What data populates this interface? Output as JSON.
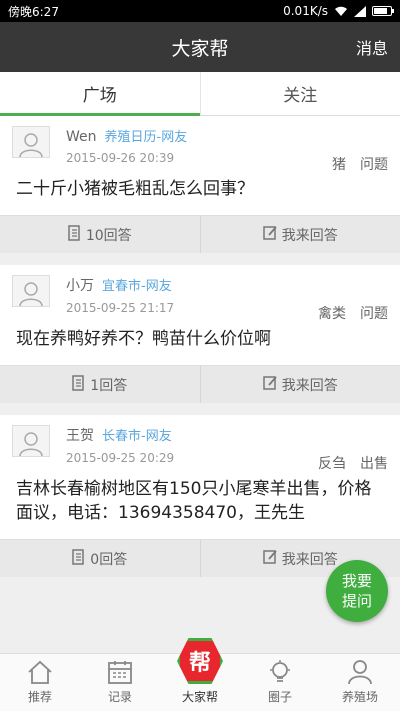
{
  "statusbar": {
    "left": "傍晚6:27",
    "speed": "0.01K/s"
  },
  "titlebar": {
    "title": "大家帮",
    "message": "消息"
  },
  "tabs": [
    {
      "label": "广场"
    },
    {
      "label": "关注"
    }
  ],
  "posts": [
    {
      "user": "Wen",
      "source": "养殖日历-网友",
      "time": "2015-09-26 20:39",
      "tags": [
        "猪",
        "问题"
      ],
      "question": "二十斤小猪被毛粗乱怎么回事？",
      "answers": "10回答",
      "reply": "我来回答"
    },
    {
      "user": "小万",
      "source": "宜春市-网友",
      "time": "2015-09-25 21:17",
      "tags": [
        "禽类",
        "问题"
      ],
      "question": "现在养鸭好养不？鸭苗什么价位啊",
      "answers": "1回答",
      "reply": "我来回答"
    },
    {
      "user": "王贺",
      "source": "长春市-网友",
      "time": "2015-09-25 20:29",
      "tags": [
        "反刍",
        "出售"
      ],
      "question": "吉林长春榆树地区有150只小尾寒羊出售，价格面议，电话：13694358470，王先生",
      "answers": "0回答",
      "reply": "我来回答"
    }
  ],
  "fab": {
    "line1": "我要",
    "line2": "提问"
  },
  "nav": [
    {
      "label": "推荐"
    },
    {
      "label": "记录"
    },
    {
      "label": "大家帮",
      "badge": "帮"
    },
    {
      "label": "圈子"
    },
    {
      "label": "养殖场"
    }
  ]
}
